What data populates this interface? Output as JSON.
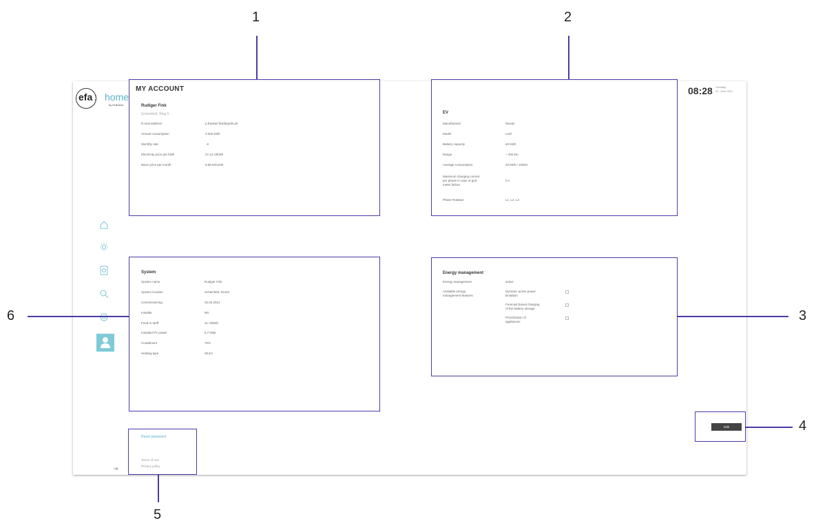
{
  "logo": {
    "efa": "efa",
    "home": "home",
    "by": "by M.Bokert"
  },
  "clock": {
    "time": "08:28",
    "day": "Tuesday,",
    "date": "22. June 2021"
  },
  "page_title": "MY ACCOUNT",
  "account": {
    "name": "Rudiger Fink",
    "address": "Scheinfeld, Weg 5",
    "rows": [
      {
        "label": "E-mail address",
        "value": "p.frankeir.fink@grids.de"
      },
      {
        "label": "Annual consumption",
        "value": "3.000 kWh"
      },
      {
        "label": "Monthly rate",
        "value": "- €"
      },
      {
        "label": "Electricity price per kWh",
        "value": "27,12 ct/kWh"
      },
      {
        "label": "Basic price per month",
        "value": "9,99 €/month"
      }
    ]
  },
  "ev": {
    "title": "EV",
    "rows": [
      {
        "label": "Manufacturer",
        "value": "Nissan"
      },
      {
        "label": "Model",
        "value": "Leaf"
      },
      {
        "label": "Battery capacity",
        "value": "40 kWh"
      },
      {
        "label": "Range",
        "value": "~ 200 km"
      },
      {
        "label": "Average consumption",
        "value": "20 kWh / 100km"
      }
    ],
    "max_current_label_1": "Maximum charging current",
    "max_current_label_2": "per phase in case of grid",
    "max_current_label_3": "meter failure",
    "max_current_value": "0 A",
    "phase_label": "Phase Rotation",
    "phase_value": "L1, L2, L3"
  },
  "system": {
    "title": "System",
    "rows": [
      {
        "label": "System name",
        "value": "Rudiger Fink"
      },
      {
        "label": "System location",
        "value": "Scheinfeld, 91443"
      },
      {
        "label": "Commissioning",
        "value": "25.02.2021"
      },
      {
        "label": "Installer",
        "value": "RD"
      },
      {
        "label": "Feed-in tariff",
        "value": "21 ct/kWh"
      },
      {
        "label": "Installed PV power",
        "value": "6,7 kWp"
      },
      {
        "label": "Curtailment",
        "value": "70%"
      },
      {
        "label": "Heating type",
        "value": "Strom"
      }
    ]
  },
  "energy": {
    "title": "Energy management",
    "status_label": "Energy management",
    "status_value": "active",
    "features_label_1": "Available energy",
    "features_label_2": "management features",
    "features": [
      {
        "line1": "Dynamic active power",
        "line2": "limitation"
      },
      {
        "line1": "Forecast based charging",
        "line2": "of the battery storage"
      },
      {
        "line1": "Prioritization of",
        "line2": "appliances"
      }
    ]
  },
  "footer": {
    "reset": "Reset password",
    "terms": "Terms of use",
    "privacy": "Privacy policy"
  },
  "edit_label": "Edit",
  "callouts": {
    "n1": "1",
    "n2": "2",
    "n3": "3",
    "n4": "4",
    "n5": "5",
    "n6": "6"
  },
  "colors": {
    "callout": "#4a3aa6",
    "accent": "#7fcad8",
    "brand_text": "#5ab0c8"
  }
}
